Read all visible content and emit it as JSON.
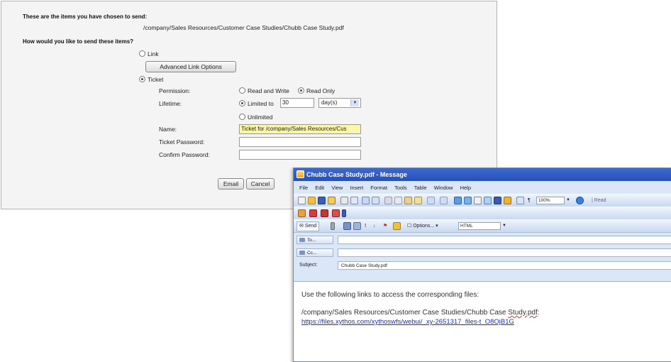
{
  "send_panel": {
    "items_heading": "These are the items you have chosen to send:",
    "item_path": "/company/Sales Resources/Customer Case Studies/Chubb Case Study.pdf",
    "how_heading": "How would you like to send these items?",
    "link_option": "Link",
    "advanced_link_options": "Advanced Link Options",
    "ticket_option": "Ticket",
    "permission_label": "Permission:",
    "perm_read_write": "Read and Write",
    "perm_read_only": "Read Only",
    "lifetime_label": "Lifetime:",
    "limited_to": "Limited to",
    "lifetime_value": "30",
    "lifetime_unit": "day(s)",
    "unlimited": "Unlimited",
    "name_label": "Name:",
    "name_value": "Ticket for /company/Sales Resources/Cus",
    "ticket_password_label": "Ticket Password:",
    "confirm_password_label": "Confirm Password:",
    "email_button": "Email",
    "cancel_button": "Cancel"
  },
  "message_window": {
    "title": "Chubb Case Study.pdf - Message",
    "menu": [
      "File",
      "Edit",
      "View",
      "Insert",
      "Format",
      "Tools",
      "Table",
      "Window",
      "Help"
    ],
    "toolbar": {
      "zoom": "100%",
      "read": "Read",
      "send": "Send",
      "options": "Options...",
      "format": "HTML"
    },
    "to_button": "To...",
    "cc_button": "Cc...",
    "subject_label": "Subject:",
    "subject_value": "Chubb Case Study.pdf",
    "body_intro": "Use the following links to access the corresponding files:",
    "body_path_prefix": "/company/Sales Resources/Customer Case Studies/Chubb Case ",
    "body_path_misspelled": "Study.pdf",
    "body_path_suffix": ":",
    "body_link": "https://files.xythos.com/xythoswfs/webui/_xy-2651317_files-t_O8OjB1G"
  }
}
